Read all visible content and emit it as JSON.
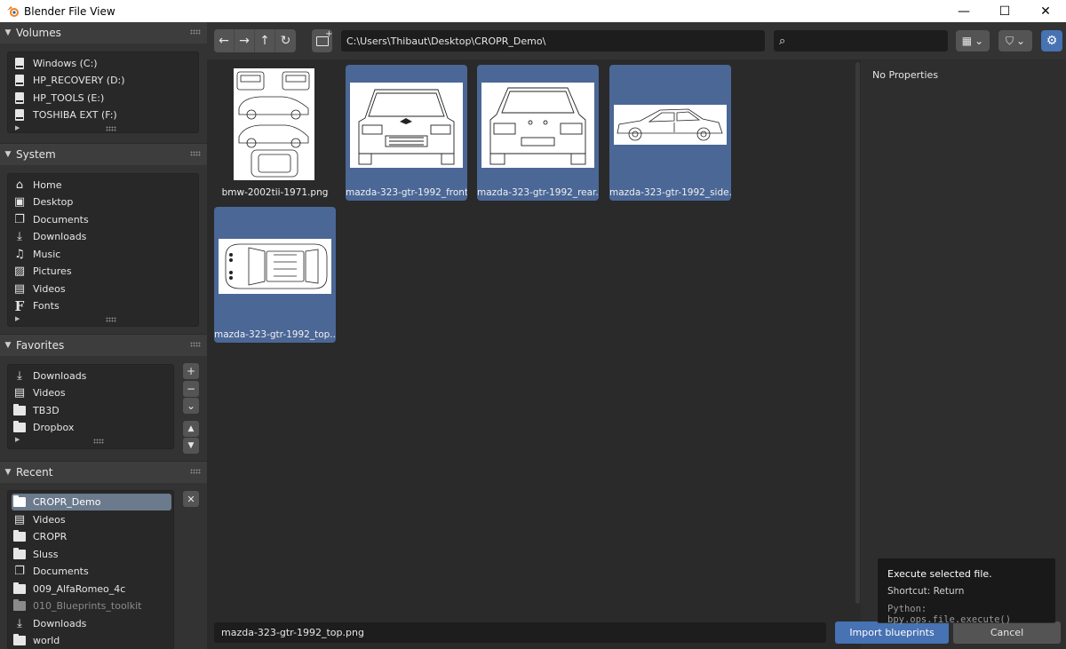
{
  "window": {
    "title": "Blender File View",
    "minimize": "—",
    "maximize": "☐",
    "close": "✕"
  },
  "sidebar": {
    "volumes": {
      "title": "Volumes",
      "items": [
        {
          "label": "Windows  (C:)",
          "icon": "drive-icon"
        },
        {
          "label": "HP_RECOVERY (D:)",
          "icon": "drive-icon"
        },
        {
          "label": "HP_TOOLS (E:)",
          "icon": "drive-icon"
        },
        {
          "label": "TOSHIBA EXT (F:)",
          "icon": "drive-icon"
        }
      ]
    },
    "system": {
      "title": "System",
      "items": [
        {
          "label": "Home",
          "icon": "home-icon"
        },
        {
          "label": "Desktop",
          "icon": "desktop-icon"
        },
        {
          "label": "Documents",
          "icon": "documents-icon"
        },
        {
          "label": "Downloads",
          "icon": "download-icon"
        },
        {
          "label": "Music",
          "icon": "music-icon"
        },
        {
          "label": "Pictures",
          "icon": "pictures-icon"
        },
        {
          "label": "Videos",
          "icon": "film-icon"
        },
        {
          "label": "Fonts",
          "icon": "font-icon"
        }
      ]
    },
    "favorites": {
      "title": "Favorites",
      "items": [
        {
          "label": "Downloads",
          "icon": "download-icon"
        },
        {
          "label": "Videos",
          "icon": "film-icon"
        },
        {
          "label": "TB3D",
          "icon": "folder-icon"
        },
        {
          "label": "Dropbox",
          "icon": "folder-icon"
        }
      ],
      "buttons": {
        "add": "+",
        "remove": "−",
        "menu": "⌄",
        "up": "▲",
        "down": "▼"
      }
    },
    "recent": {
      "title": "Recent",
      "items": [
        {
          "label": "CROPR_Demo",
          "icon": "folder-icon",
          "active": true
        },
        {
          "label": "Videos",
          "icon": "film-icon"
        },
        {
          "label": "CROPR",
          "icon": "folder-icon"
        },
        {
          "label": "Sluss",
          "icon": "folder-icon"
        },
        {
          "label": "Documents",
          "icon": "documents-icon"
        },
        {
          "label": "009_AlfaRomeo_4c",
          "icon": "folder-icon"
        },
        {
          "label": "010_Blueprints_toolkit",
          "icon": "folder-icon",
          "dim": true
        },
        {
          "label": "Downloads",
          "icon": "download-icon"
        },
        {
          "label": "world",
          "icon": "folder-icon"
        }
      ],
      "clear": "✕"
    }
  },
  "toolbar": {
    "back": "←",
    "forward": "→",
    "parent": "↑",
    "refresh": "↻",
    "new_folder": "+",
    "path": "C:\\Users\\Thibaut\\Desktop\\CROPR_Demo\\",
    "search_value": "",
    "search_icon": "⌕",
    "display_mode": "▦",
    "filter": "⛉",
    "dropdown_arrow": "⌄",
    "settings": "⚙"
  },
  "files": [
    {
      "name": "bmw-2002tii-1971.png",
      "selected": false,
      "kind": "sheet"
    },
    {
      "name": "mazda-323-gtr-1992_front....",
      "selected": true,
      "kind": "front"
    },
    {
      "name": "mazda-323-gtr-1992_rear....",
      "selected": true,
      "kind": "rear"
    },
    {
      "name": "mazda-323-gtr-1992_side....",
      "selected": true,
      "kind": "side"
    },
    {
      "name": "mazda-323-gtr-1992_top....",
      "selected": true,
      "kind": "top"
    }
  ],
  "properties": {
    "empty_text": "No Properties"
  },
  "footer": {
    "filename": "mazda-323-gtr-1992_top.png",
    "execute_label": "Import blueprints",
    "cancel_label": "Cancel"
  },
  "tooltip": {
    "line1": "Execute selected file.",
    "line2": "Shortcut: Return",
    "line3": "Python: bpy.ops.file.execute()"
  },
  "colors": {
    "accent": "#4772b3",
    "selection": "#4a6796",
    "background": "#2a2a2a"
  }
}
